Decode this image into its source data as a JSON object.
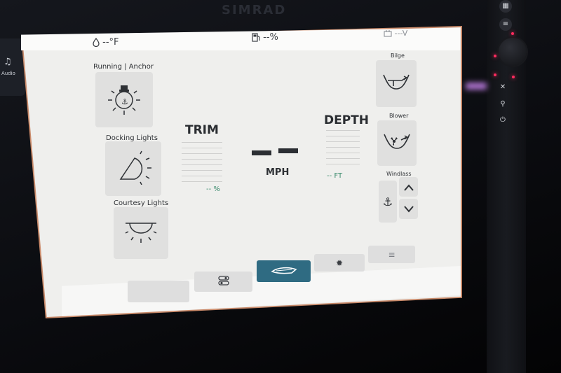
{
  "device": {
    "brand": "SIMRAD"
  },
  "side_tab": {
    "icon": "music-note-icon",
    "label": "Audio"
  },
  "status_bar": {
    "temperature": "--°F",
    "fuel": "--%",
    "battery": "---V"
  },
  "left_column": {
    "items": [
      {
        "label": "Running | Anchor",
        "icon": "navigation-light-icon"
      },
      {
        "label": "Docking Lights",
        "icon": "docking-light-icon"
      },
      {
        "label": "Courtesy Lights",
        "icon": "courtesy-light-icon"
      }
    ]
  },
  "gauges": {
    "trim": {
      "title": "TRIM",
      "readout": "-- %"
    },
    "speed": {
      "unit": "MPH"
    },
    "depth": {
      "title": "DEPTH",
      "readout": "-- FT"
    }
  },
  "right_column": {
    "bilge": {
      "label": "Bilge",
      "icon": "bilge-pump-icon"
    },
    "blower": {
      "label": "Blower",
      "icon": "blower-fan-icon"
    },
    "windlass": {
      "label": "Windlass",
      "icon": "anchor-icon"
    }
  },
  "bottom_nav": {
    "tabs": [
      {
        "icon": "blank"
      },
      {
        "icon": "switches-icon"
      },
      {
        "icon": "boat-icon",
        "active": true
      },
      {
        "icon": "brightness-icon"
      },
      {
        "icon": "menu-icon"
      }
    ]
  },
  "colors": {
    "accent": "#2f6b82",
    "readout": "#3b8b6d"
  }
}
